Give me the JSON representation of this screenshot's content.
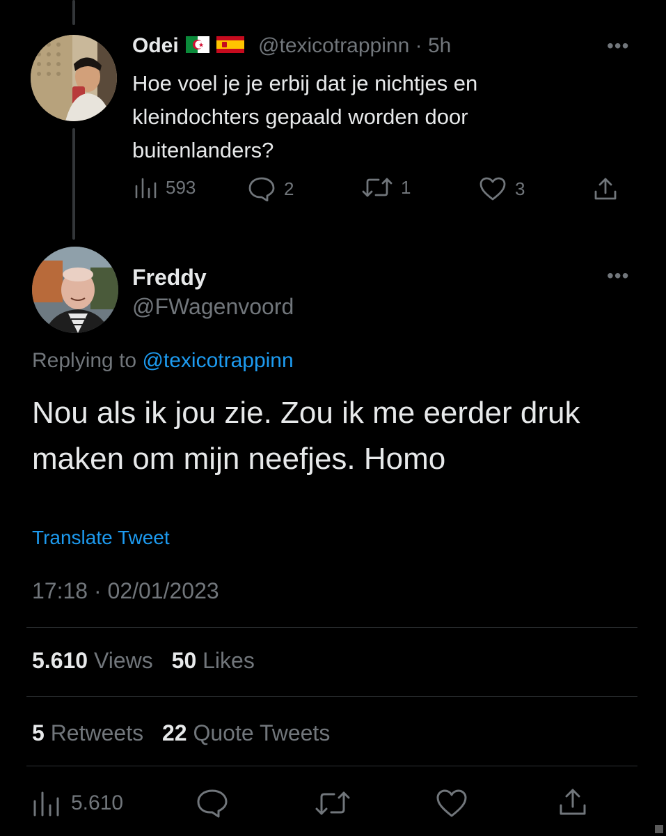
{
  "parent_tweet": {
    "author_name": "Odei",
    "flags": [
      "algeria-flag",
      "spain-flag"
    ],
    "handle": "@texicotrappinn",
    "separator": "·",
    "time_ago": "5h",
    "text": "Hoe voel je je erbij dat je nichtjes en kleindochters gepaald worden door buitenlanders?",
    "more_label": "•••",
    "actions": {
      "views": "593",
      "replies": "2",
      "retweets": "1",
      "likes": "3"
    }
  },
  "reply_tweet": {
    "author_name": "Freddy",
    "handle": "@FWagenvoord",
    "more_label": "•••",
    "replying_prefix": "Replying to",
    "replying_to": "@texicotrappinn",
    "text": "Nou als ik jou zie. Zou ik me eerder druk maken om mijn neefjes. Homo",
    "translate_label": "Translate Tweet",
    "timestamp": "17:18 · 02/01/2023",
    "stats": {
      "views_count": "5.610",
      "views_label": "Views",
      "likes_count": "50",
      "likes_label": "Likes",
      "retweets_count": "5",
      "retweets_label": "Retweets",
      "quote_count": "22",
      "quote_label": "Quote Tweets"
    },
    "bottom_bar": {
      "views": "5.610"
    }
  },
  "icons": {
    "views": "bar-chart-icon",
    "reply": "speech-bubble-icon",
    "retweet": "retweet-icon",
    "like": "heart-icon",
    "share": "share-icon"
  },
  "colors": {
    "background": "#000000",
    "text_primary": "#e7e9ea",
    "text_muted": "#71767b",
    "link": "#1d9bf0",
    "divider": "#2f3336"
  }
}
